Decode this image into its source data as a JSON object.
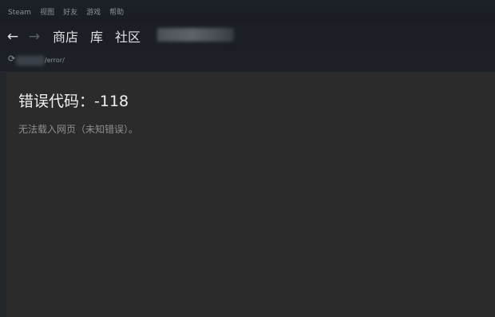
{
  "menu": {
    "items": [
      "Steam",
      "视图",
      "好友",
      "游戏",
      "帮助"
    ]
  },
  "nav": {
    "back_icon": "←",
    "forward_icon": "→",
    "tabs": [
      "商店",
      "库",
      "社区"
    ]
  },
  "urlbar": {
    "reload_icon": "⟳",
    "url": "/error/"
  },
  "page": {
    "error_title": "错误代码：-118",
    "error_message": "无法载入网页（未知错误）。"
  },
  "colors": {
    "background": "#2b2b2b",
    "chrome": "#1b1e24",
    "text_primary": "#efefef",
    "text_secondary": "#8f8f8f"
  }
}
